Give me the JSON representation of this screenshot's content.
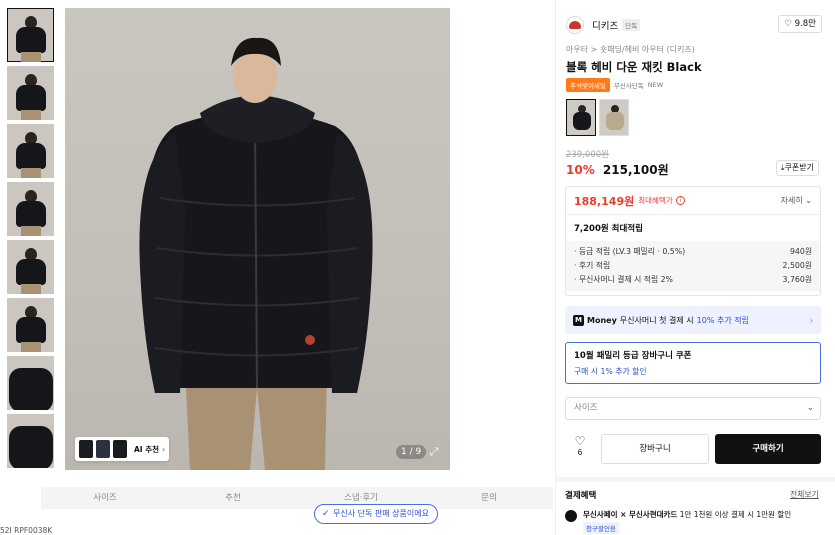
{
  "gallery": {
    "counter": "1 / 9",
    "ai_label": "AI 추천",
    "thumbnails": [
      {
        "kind": "front"
      },
      {
        "kind": "front"
      },
      {
        "kind": "side"
      },
      {
        "kind": "back"
      },
      {
        "kind": "front"
      },
      {
        "kind": "front"
      },
      {
        "kind": "close"
      },
      {
        "kind": "close"
      }
    ]
  },
  "tabs": [
    "사이즈",
    "추천",
    "스냅·후기",
    "문의"
  ],
  "toast": "무신사 단독 판매 상품이에요",
  "sku": "52I RPF0038K",
  "brand": {
    "name": "디키즈",
    "tag": "단독",
    "likes": "9.8만"
  },
  "breadcrumb": "아우터 > 숏패딩/헤비 아우터 (디키즈)",
  "product": {
    "title": "블록 헤비 다운 재킷 Black",
    "badges": {
      "orange": "추석맞이세일",
      "exclusive": "무신사단독",
      "new": "NEW"
    },
    "original_price": "239,000원",
    "discount": "10%",
    "price": "215,100원",
    "coupon_button": "쿠폰받기"
  },
  "benefit": {
    "max_price": "188,149원",
    "max_label": "최대혜택가",
    "detail": "자세히",
    "points_title": "7,200원 최대적립",
    "items": [
      {
        "label": "· 등급 적립 (LV.3 패밀리 · 0.5%)",
        "value": "940원"
      },
      {
        "label": "· 후기 적립",
        "value": "2,500원"
      },
      {
        "label": "· 무신사머니 결제 시 적립 2%",
        "value": "3,760원"
      }
    ]
  },
  "money_bar": {
    "icon": "M",
    "brand": "Money",
    "text": "무신사머니 첫 결제 시",
    "highlight": "10% 추가 적립"
  },
  "coupon": {
    "title": "10월 패밀리 등급 장바구니 쿠폰",
    "desc": "구매 시 1% 추가 할인"
  },
  "size_select": {
    "placeholder": "사이즈"
  },
  "actions": {
    "like_count": "6",
    "cart": "장바구니",
    "buy": "구매하기"
  },
  "payment": {
    "heading": "결제혜택",
    "see_all": "전체보기",
    "line1_bold": "무신사페이 × 무신사현대카드",
    "line1_rest": " 1만 1천원 이상 결제 시 1만원 할인",
    "tag": "청구할인용"
  },
  "colors": {
    "accent_red": "#ef3b2b",
    "accent_blue": "#2a4fd0",
    "jacket": "#16171b",
    "pants": "#a99273",
    "background": "#c6c2bc"
  }
}
